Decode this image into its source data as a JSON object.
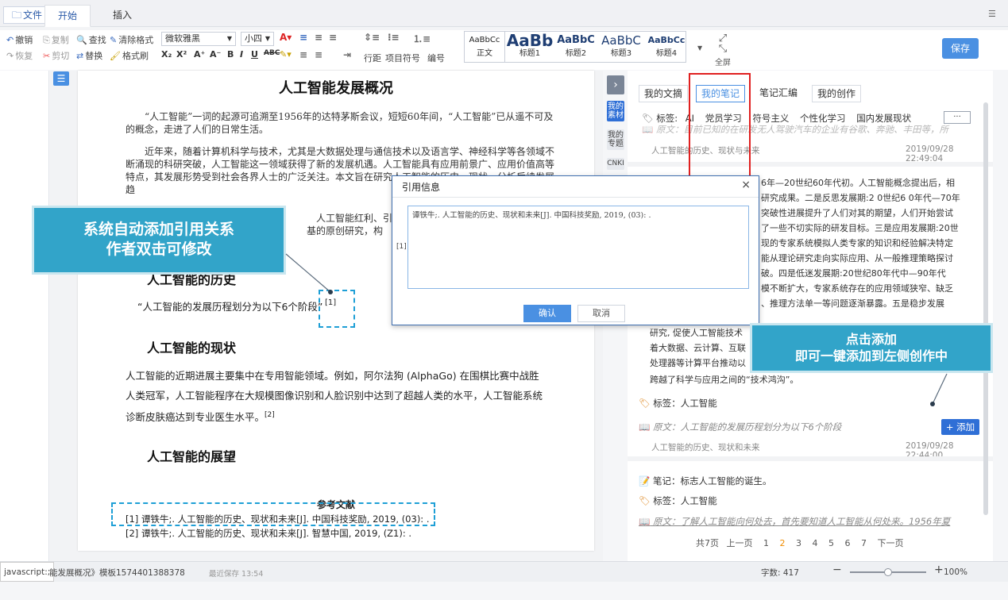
{
  "ribbon": {
    "tabs": {
      "file": "文件",
      "start": "开始",
      "insert": "插入"
    },
    "edit": {
      "undo": "撤销",
      "copy": "复制",
      "find": "查找",
      "clear_format": "清除格式",
      "redo": "恢复",
      "cut": "剪切",
      "replace": "替换",
      "format_painter": "格式刷"
    },
    "font_name": "微软雅黑",
    "font_size": "小四",
    "para_labels": {
      "line_spacing": "行距",
      "bullets": "项目符号",
      "numbering": "编号"
    },
    "styles": [
      {
        "big": "AaBbCc",
        "sub": "正文"
      },
      {
        "big": "AaBb",
        "sub": "标题1"
      },
      {
        "big": "AaBbC",
        "sub": "标题2"
      },
      {
        "big": "AaBbC",
        "sub": "标题3"
      },
      {
        "big": "AaBbCc",
        "sub": "标题4"
      }
    ],
    "fullscreen": "全屏",
    "save": "保存"
  },
  "doc": {
    "title": "人工智能发展概况",
    "p1": "“人工智能”一词的起源可追溯至1956年的达特茅斯会议，短短60年间，“人工智能”已从遥不可及的概念，走进了人们的日常生活。",
    "p2": "近年来，随着计算机科学与技术，尤其是大数据处理与通信技术以及语言学、神经科学等各领域不断涌现的科研突破，人工智能这一领域获得了新的发展机遇。人工智能具有应用前景广、应用价值高等特点，其发展形势受到社会各界人士的广泛关注。本文旨在研究人工智能的历史、现状，分析后续发展趋",
    "p3_a": "人工智能红利、引",
    "p3_b": "基的原创研究，构",
    "h_history": "人工智能的历史",
    "history_line": "“人工智能的发展历程划分为以下6个阶段”",
    "cite1": "[1]",
    "h_status": "人工智能的现状",
    "status_l1": "人工智能的近期进展主要集中在专用智能领域。例如，阿尔法狗 (AlphaGo) 在围棋比赛中战胜",
    "status_l2": "人类冠军，人工智能程序在大规模图像识别和人脸识别中达到了超越人类的水平，人工智能系统",
    "status_l3": "诊断皮肤癌达到专业医生水平。",
    "cite2": "[2]",
    "h_outlook": "人工智能的展望",
    "refs_title": "参考文献",
    "ref1": "[1] 谭铁牛;. 人工智能的历史、现状和未来[J]. 中国科技奖励, 2019, (03): .",
    "ref2": "[2] 谭铁牛;. 人工智能的历史、现状和未来[J]. 智慧中国, 2019, (Z1): ."
  },
  "side_tabs": {
    "material": "我的素材",
    "topic": "我的专题",
    "cnki": "CNKI"
  },
  "panel": {
    "tabs": {
      "excerpt": "我的文摘",
      "notes": "我的笔记",
      "collection": "笔记汇编",
      "creation": "我的创作"
    },
    "tags_bar": {
      "label": "标签:",
      "items": [
        "AI",
        "党员学习",
        "符号主义",
        "个性化学习",
        "国内发展现状"
      ],
      "more": "···"
    },
    "card1_source": "原文：目前已知的在研发无人驾驶汽车的企业有谷歌、奔驰、丰田等，所",
    "card1_meta": "人工智能的历史、现状与未来",
    "card1_time": "2019/09/28 22:49:04",
    "card2_lines": [
      "6年—20世纪60年代初。人工智能概念提出后，相",
      "研究成果。二是反思发展期:2 0世纪6 0年代—70年",
      "突破性进展提升了人们对其的期望，人们开始尝试",
      "了一些不切实际的研发目标。三是应用发展期:20世",
      "现的专家系统模拟人类专家的知识和经验解决特定",
      "能从理论研究走向实际应用、从一般推理策略探讨",
      "破。四是低迷发展期:20世纪80年代中—90年代",
      "模不断扩大，专家系统存在的应用领域狭窄、缺乏",
      "、推理方法单一等问题逐渐暴露。五是稳步发展"
    ],
    "card2_l10": "研究, 促使人工智能技术",
    "card2_l11": "着大数据、云计算、互联",
    "card2_l12": "处理器等计算平台推动以",
    "card2_l13": "跨越了科学与应用之间的“技术鸿沟”。",
    "card2_tag": "标签：人工智能",
    "card2_source": "原文：人工智能的发展历程划分为以下6个阶段",
    "add_btn": "+ 添加",
    "card2_meta": "人工智能的历史、现状和未来",
    "card2_time": "2019/09/28 22:44:00",
    "card3_note": "笔记：标志人工智能的诞生。",
    "card3_tag": "标签：人工智能",
    "card3_source": "原文：了解人工智能向何处去，首先要知道人工智能从何处来。1956年夏",
    "pager": {
      "total": "共7页",
      "prev": "上一页",
      "pages": [
        "1",
        "2",
        "3",
        "4",
        "5",
        "6",
        "7"
      ],
      "next": "下一页"
    }
  },
  "dialog": {
    "title": "引用信息",
    "close": "×",
    "ref_text": "谭铁牛;. 人工智能的历史、现状和未来[J]. 中国科技奖励, 2019, (03): .",
    "ref_index": "[1]",
    "ok": "确认",
    "cancel": "取消"
  },
  "callouts": {
    "left_l1": "系统自动添加引用关系",
    "left_l2": "作者双击可修改",
    "right_l1": "点击添加",
    "right_l2": "即可一键添加到左侧创作中"
  },
  "status": {
    "js": "javascript:;",
    "doc_name": "能发展概况》模板1574401388378",
    "last_saved": "最近保存 13:54",
    "wordcount": "字数: 417",
    "zoom": "100%"
  },
  "colors": {
    "accent": "#4a90e2",
    "callout": "#32a4c9",
    "highlight": "#e02020",
    "dash": "#1e9fd6"
  }
}
